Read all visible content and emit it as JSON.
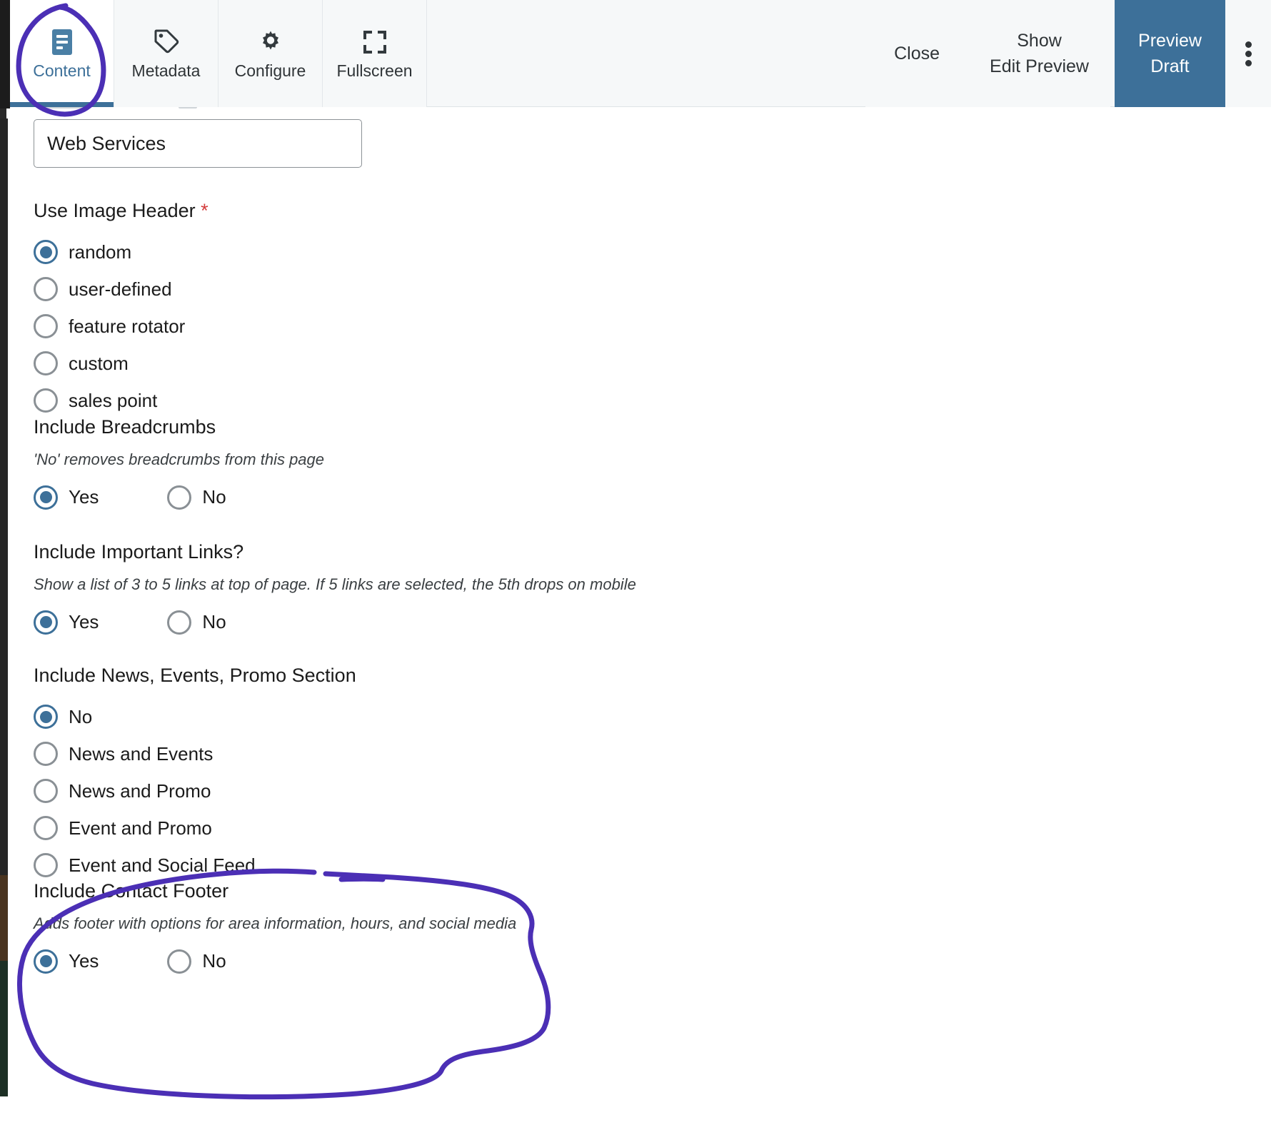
{
  "toolbar": {
    "tabs": [
      {
        "label": "Content",
        "icon": "document-icon",
        "active": true
      },
      {
        "label": "Metadata",
        "icon": "tag-icon",
        "active": false
      },
      {
        "label": "Configure",
        "icon": "gear-icon",
        "active": false
      },
      {
        "label": "Fullscreen",
        "icon": "fullscreen-icon",
        "active": false
      }
    ],
    "close_label": "Close",
    "show_edit_preview_line1": "Show",
    "show_edit_preview_line2": "Edit Preview",
    "preview_draft_line1": "Preview",
    "preview_draft_line2": "Draft",
    "overflow_icon": "kebab-menu-icon",
    "accent_color": "#3d7099",
    "active_tab_color": "#3d7099"
  },
  "form": {
    "title_field": {
      "value": "Web Services",
      "placeholder": "Title"
    },
    "image_header": {
      "label": "Use Image Header",
      "required_marker": "*",
      "required_color": "#d33c3c",
      "selected": "random",
      "options": [
        "random",
        "user-defined",
        "feature rotator",
        "custom",
        "sales point"
      ]
    },
    "breadcrumbs": {
      "label": "Include Breadcrumbs",
      "help": "'No' removes breadcrumbs from this page",
      "selected": "Yes",
      "options": [
        "Yes",
        "No"
      ]
    },
    "important_links": {
      "label": "Include Important Links?",
      "help": "Show a list of 3 to 5 links at top of page. If 5 links are selected, the 5th drops on mobile",
      "selected": "Yes",
      "options": [
        "Yes",
        "No"
      ]
    },
    "news_events_promo": {
      "label": "Include News, Events, Promo Section",
      "selected": "No",
      "options": [
        "No",
        "News and Events",
        "News and Promo",
        "Event and Promo",
        "Event and Social Feed"
      ]
    },
    "contact_footer": {
      "label": "Include Contact Footer",
      "help": "Adds footer with options for area information, hours, and social media",
      "selected": "Yes",
      "options": [
        "Yes",
        "No"
      ]
    }
  },
  "annotations": {
    "color": "#4b2fb5",
    "shapes": [
      {
        "name": "content-tab-circle-annotation",
        "target": "Content tab"
      },
      {
        "name": "contact-footer-circle-annotation",
        "target": "Include Contact Footer"
      }
    ]
  }
}
